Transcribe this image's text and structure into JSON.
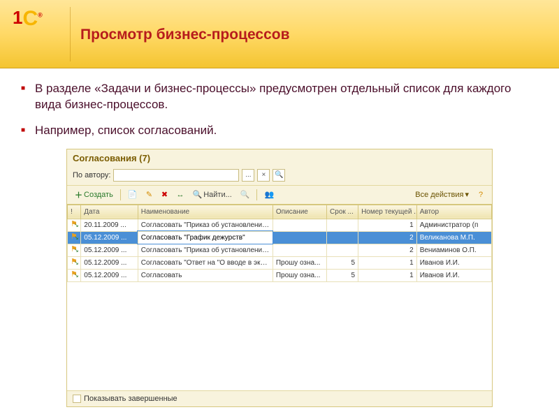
{
  "header": {
    "title": "Просмотр бизнес-процессов"
  },
  "bullets": [
    "В разделе «Задачи и бизнес-процессы» предусмотрен отдельный список для каждого вида бизнес-процессов.",
    "Например, список согласований."
  ],
  "app": {
    "title": "Согласования (7)",
    "filter_label": "По автору:",
    "filter_value": "",
    "toolbar": {
      "create": "Создать",
      "find": "Найти...",
      "all_actions": "Все действия"
    },
    "columns": {
      "alert": "!",
      "date": "Дата",
      "name": "Наименование",
      "desc": "Описание",
      "term": "Срок ...",
      "num": "Номер текущей ...",
      "author": "Автор"
    },
    "rows": [
      {
        "date": "20.11.2009 ...",
        "name": "Согласовать \"Приказ об установлении п...",
        "desc": "",
        "term": "",
        "num": "1",
        "author": "Администратор (п",
        "sel": false
      },
      {
        "date": "05.12.2009 ...",
        "name": "Согласовать \"График дежурств\"",
        "desc": "",
        "term": "",
        "num": "2",
        "author": "Великанова М.П.",
        "sel": true
      },
      {
        "date": "05.12.2009 ...",
        "name": "Согласовать \"Приказ об установлении п...",
        "desc": "",
        "term": "",
        "num": "2",
        "author": "Вениаминов О.П.",
        "sel": false
      },
      {
        "date": "05.12.2009 ...",
        "name": "Согласовать \"Ответ на \"О вводе в экспл...",
        "desc": "Прошу озна...",
        "term": "5",
        "num": "1",
        "author": "Иванов И.И.",
        "sel": false
      },
      {
        "date": "05.12.2009 ...",
        "name": "Согласовать",
        "desc": "Прошу озна...",
        "term": "5",
        "num": "1",
        "author": "Иванов И.И.",
        "sel": false
      }
    ],
    "show_completed": "Показывать завершенные"
  }
}
